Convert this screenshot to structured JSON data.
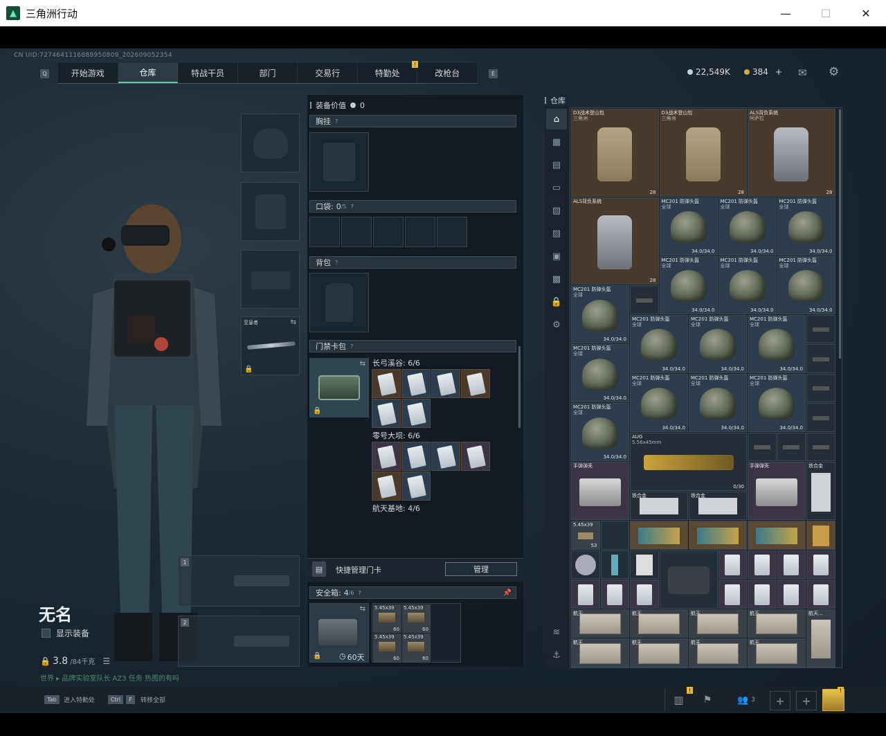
{
  "window": {
    "title": "三角洲行动"
  },
  "header": {
    "uid": "CN UID:7274641116888950809_202609052354",
    "tabs": [
      {
        "label": "开始游戏"
      },
      {
        "label": "仓库",
        "active": true
      },
      {
        "label": "特战干员"
      },
      {
        "label": "部门"
      },
      {
        "label": "交易行"
      },
      {
        "label": "特勤处",
        "badge": "!"
      },
      {
        "label": "改枪台"
      }
    ],
    "key_left": "Q",
    "key_right": "E",
    "currency_silver": "22,549K",
    "currency_gold": "384",
    "gold_plus": "+"
  },
  "character": {
    "name": "无名",
    "show_equipment": "显示装备",
    "weight": "3.8",
    "weight_max": "/84千克",
    "task_text": "世界 ▸ 品牌实验室队长 AZ3 任务 热图的有吗",
    "weapon_slot_1": "1",
    "weapon_slot_2": "2",
    "melee_label": "至皇者"
  },
  "loadout": {
    "equipment_value_label": "装备价值",
    "equipment_value": "0",
    "chest_rig": "胸挂",
    "pockets": "口袋:",
    "pockets_count": "0",
    "pockets_max": "/5",
    "backpack": "背包",
    "keycard_case": "门禁卡包",
    "maps": [
      {
        "name": "长弓溪谷: 6/6"
      },
      {
        "name": "零号大坝: 6/6"
      },
      {
        "name": "航天基地: 4/6"
      }
    ],
    "quick_manage": "快捷管理门卡",
    "manage_btn": "管理",
    "safe_box": "安全箱:",
    "safe_box_count": "4",
    "safe_box_max": "/6",
    "safe_timer": "60天",
    "ammo_label": "5.45x39",
    "ammo_count": "60"
  },
  "warehouse": {
    "title": "仓库",
    "items": {
      "d3_pack": "D3战术登山包",
      "d3_pack_sub": "三角洲",
      "als_pack": "ALS背负系统",
      "als_pack_sub": "阿萨拉",
      "mc201": "MC201 防弹头盔",
      "mc201_sub": "全球",
      "helmet_dur": "34.0/34.0",
      "pack_cap": "28",
      "aug_name": "AUG",
      "aug_caliber": "5.56x45mm",
      "aug_ammo": "0/30",
      "grenade_case": "手弹弹壳",
      "steel_plate": "铁合金",
      "ammo_545": "5.45x39",
      "ammo_545_count": "53",
      "space_item": "航天..."
    }
  },
  "footer": {
    "tab_key": "Tab",
    "tab_hint": "进入特勤处",
    "ctrl_key": "Ctrl",
    "f_key": "F",
    "ctrl_hint": "转移全部",
    "squad_count": "3"
  },
  "colors": {
    "accent": "#3fe0a0",
    "badge": "#e5b63a"
  }
}
